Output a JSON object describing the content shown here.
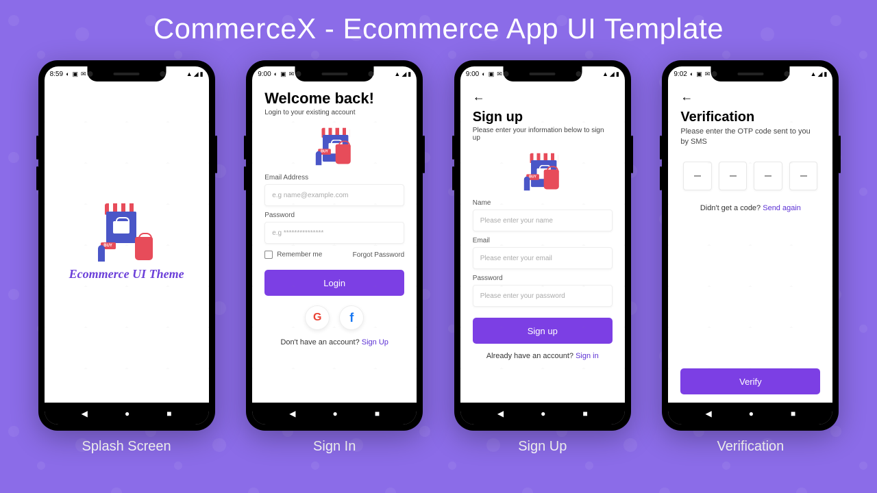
{
  "banner": {
    "title": "CommerceX - Ecommerce App UI Template"
  },
  "labels": {
    "splash": "Splash Screen",
    "signin": "Sign In",
    "signup": "Sign Up",
    "verification": "Verification"
  },
  "status": {
    "time1": "8:59",
    "time2": "9:00",
    "time3": "9:00",
    "time4": "9:02"
  },
  "splash": {
    "appName": "Ecommerce UI Theme",
    "buy": "BUY"
  },
  "signin": {
    "title": "Welcome back!",
    "subtitle": "Login to your existing account",
    "emailLabel": "Email Address",
    "emailPlaceholder": "e.g name@example.com",
    "passwordLabel": "Password",
    "passwordPlaceholder": "e.g ***************",
    "remember": "Remember me",
    "forgot": "Forgot Password",
    "loginBtn": "Login",
    "noAccount": "Don't have an account? ",
    "signupLink": "Sign Up"
  },
  "signup": {
    "title": "Sign up",
    "subtitle": "Please enter your information below to sign up",
    "nameLabel": "Name",
    "namePlaceholder": "Please enter your name",
    "emailLabel": "Email",
    "emailPlaceholder": "Please enter your email",
    "passwordLabel": "Password",
    "passwordPlaceholder": "Please enter your password",
    "btn": "Sign up",
    "already": "Already have an account? ",
    "signinLink": "Sign in"
  },
  "verify": {
    "title": "Verification",
    "subtitle": "Please enter the OTP code sent to you by SMS",
    "noCode": "Didn't get a code? ",
    "sendAgain": "Send again",
    "btn": "Verify"
  }
}
